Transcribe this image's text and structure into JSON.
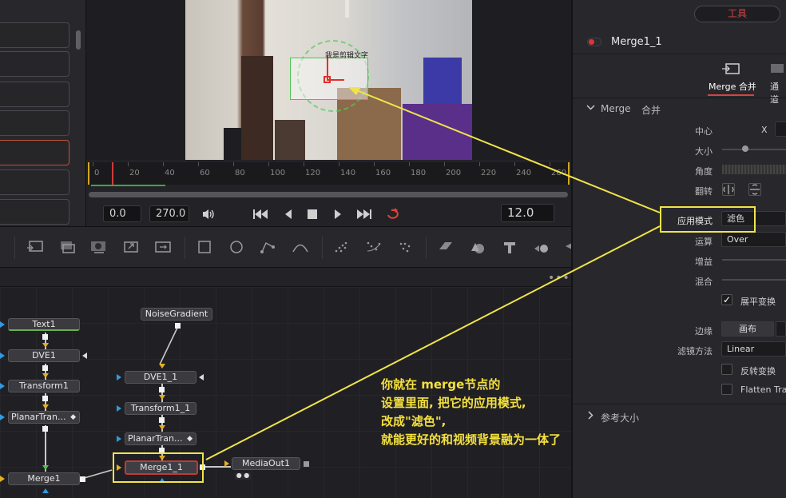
{
  "viewer": {
    "overlay_text": "我是剪辑文字",
    "timeline_ticks": [
      "0",
      "20",
      "40",
      "60",
      "80",
      "100",
      "120",
      "140",
      "160",
      "180",
      "200",
      "220",
      "240",
      "260"
    ],
    "start_time": "0.0",
    "end_time": "270.0",
    "current_frame": "12.0"
  },
  "nodes": {
    "text1": "Text1",
    "dve1": "DVE1",
    "transform1": "Transform1",
    "planartracker1": "PlanarTran...",
    "merge1": "Merge1",
    "noisegradient": "NoiseGradient",
    "dve1_1": "DVE1_1",
    "transform1_1": "Transform1_1",
    "planartracker1_1": "PlanarTran...",
    "merge1_1": "Merge1_1",
    "mediaout1": "MediaOut1"
  },
  "annotation": {
    "text": "你就在 merge节点的\n设置里面, 把它的应用模式,\n改成\"滤色\",\n就能更好的和视频背景融为一体了"
  },
  "inspector": {
    "tools_tab": "工具",
    "node_title": "Merge1_1",
    "tabs": {
      "merge": "Merge 合并",
      "channel": "通道"
    },
    "section": {
      "merge_name": "Merge",
      "merge_cn": "合并"
    },
    "props": {
      "center_label": "中心",
      "center_x": "X",
      "size_label": "大小",
      "angle_label": "角度",
      "flip_label": "翻转",
      "apply_mode_label": "应用模式",
      "apply_mode_value": "滤色",
      "operator_label": "运算",
      "operator_value": "Over",
      "gain_label": "增益",
      "blend_label": "混合",
      "flatten_label": "展平变换",
      "edges_label": "边缘",
      "edges_value": "画布",
      "filter_label": "滤镜方法",
      "filter_value": "Linear",
      "invert_label": "反转变换",
      "flatten2_label": "Flatten Tra"
    },
    "collapsed_section": "参考大小"
  }
}
